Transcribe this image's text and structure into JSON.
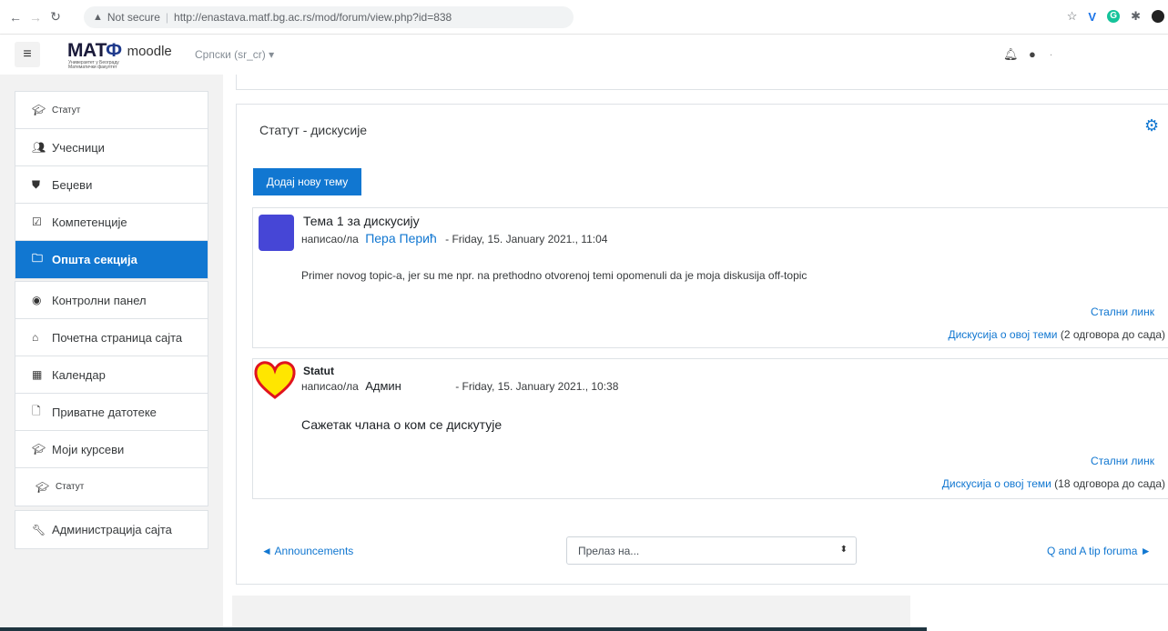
{
  "browser": {
    "security_label": "Not secure",
    "url": "http://enastava.matf.bg.ac.rs/mod/forum/view.php?id=838"
  },
  "navbar": {
    "logo_text": "МАТФ",
    "logo_subtext": "Универзитет у Београду Математички факултет",
    "site_name": "moodle",
    "language": "Српски (sr_cr)"
  },
  "sidebar": {
    "group1": [
      {
        "label": "Статут",
        "icon": "graduation-cap-icon",
        "small": true
      },
      {
        "label": "Учесници",
        "icon": "users-icon"
      },
      {
        "label": "Беџеви",
        "icon": "shield-icon"
      },
      {
        "label": "Компетенције",
        "icon": "checkbox-icon"
      },
      {
        "label": "Општа секција",
        "icon": "folder-icon",
        "active": true
      }
    ],
    "group2": [
      {
        "label": "Контролни панел",
        "icon": "dashboard-icon"
      },
      {
        "label": "Почетна страница сајта",
        "icon": "home-icon"
      },
      {
        "label": "Календар",
        "icon": "calendar-icon"
      },
      {
        "label": "Приватне датотеке",
        "icon": "file-icon"
      },
      {
        "label": "Моји курсеви",
        "icon": "graduation-cap-icon"
      },
      {
        "label": "Статут",
        "icon": "graduation-cap-icon",
        "small": true
      }
    ],
    "group3": [
      {
        "label": "Администрација сајта",
        "icon": "wrench-icon"
      }
    ]
  },
  "forum": {
    "title": "Статут - дискусије",
    "add_topic_label": "Додај нову тему",
    "posts": [
      {
        "subject": "Тема 1 за дискусију",
        "by_label": "написао/ла",
        "author": "Пера Перић",
        "date": "- Friday, 15. January 2021., 11:04",
        "body": "Primer novog topic-a, jer su me npr. na prethodno otvorenoj temi opomenuli da je moja diskusija off-topic",
        "permalink": "Стални линк",
        "discuss_link": "Дискусија о овој теми",
        "replies": "(2 одговора до сада)"
      },
      {
        "subject": "Statut",
        "by_label": "написао/ла",
        "author": "Админ",
        "date": "- Friday, 15. January 2021., 10:38",
        "body": "Сажетак члана о ком се дискутује",
        "permalink": "Стални линк",
        "discuss_link": "Дискусија о овој теми",
        "replies": "(18 одговора до сада)"
      }
    ],
    "prev_activity": "◄ Announcements",
    "jump_to_placeholder": "Прелаз на...",
    "next_activity": "Q and A tip foruma ►"
  },
  "colors": {
    "accent": "#1177d1",
    "avatar_square": "#4646d6",
    "heart_fill": "#ffe600",
    "heart_stroke": "#e0141e"
  }
}
